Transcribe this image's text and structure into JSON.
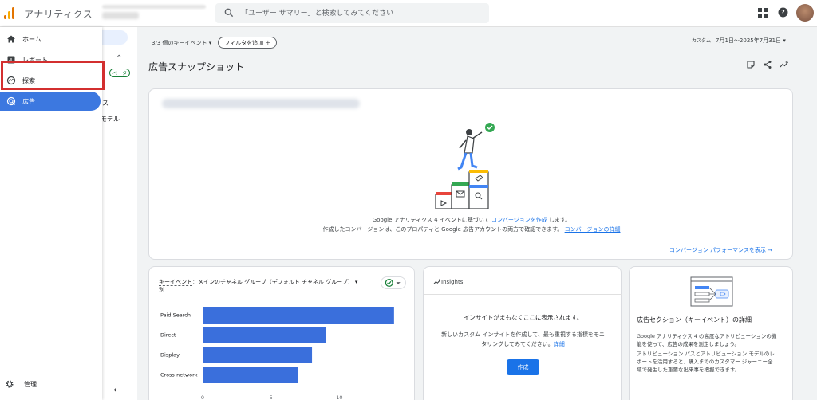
{
  "app": {
    "title": "アナリティクス"
  },
  "search": {
    "placeholder": "「ユーザー サマリー」と検索してみてください"
  },
  "colors": {
    "accent": "#1a73e8",
    "active_nav": "#3c78e0",
    "highlight": "#d32f2f",
    "chart_bar": "#3a6fdc"
  },
  "nav": {
    "items": [
      {
        "label": "ホーム",
        "icon": "home-icon"
      },
      {
        "label": "レポート",
        "icon": "reports-icon"
      },
      {
        "label": "探索",
        "icon": "explore-icon"
      },
      {
        "label": "広告",
        "icon": "advertising-icon",
        "active": true
      }
    ],
    "admin": {
      "label": "管理",
      "icon": "gear-icon"
    }
  },
  "subnav": {
    "beta": "ベータ",
    "item1": "ス",
    "item2": "モデル"
  },
  "filters": {
    "key_events": "3/3 個のキーイベント ▾",
    "add_filter": "フィルタを追加 ＋"
  },
  "date_range": {
    "mode": "カスタム",
    "range": "7月1日～2025年7月31日 ▾"
  },
  "page": {
    "title": "広告スナップショット"
  },
  "conversions": {
    "line1_pre": "Google アナリティクス 4 イベントに基づいて",
    "line1_link": "コンバージョンを作成",
    "line1_post": "します。",
    "line2_pre": "作成したコンバージョンは、このプロパティと Google 広告アカウントの両方で確認できます。",
    "line2_link": "コンバージョンの詳細",
    "perf_link": "コンバージョン パフォーマンスを表示 →"
  },
  "chart_card": {
    "title_key": "キーイベント",
    "title_rest": "：メインのチャネル グループ（デフォルト チャネル グループ） ▾",
    "title_line2": "別"
  },
  "chart_data": {
    "type": "bar",
    "orientation": "horizontal",
    "categories": [
      "Paid Search",
      "Direct",
      "Display",
      "Cross-network"
    ],
    "values": [
      14,
      9,
      8,
      7
    ],
    "xticks": [
      0,
      5,
      10
    ],
    "xlim": [
      0,
      14.3
    ],
    "grid": false
  },
  "insights": {
    "header": "Insights",
    "heading": "インサイトがまもなくここに表示されます。",
    "desc_line1": "新しいカスタム インサイトを作成して、最も重視する指標をモニ",
    "desc_line2_pre": "タリングしてみてください。",
    "desc_link": "詳細",
    "create_button": "作成"
  },
  "attribution": {
    "title": "広告セクション（キーイベント）の詳細",
    "p1_l1": "Google アナリティクス 4 の高度なアトリビューションの機",
    "p1_l2": "能を使って、広告の成果を測定しましょう。",
    "p2_l1": "アトリビューション パスとアトリビューション モデルのレ",
    "p2_l2": "ポートを活用すると、購入までのカスタマー ジャーニー全",
    "p2_l3": "域で発生した重要な出来事を把握できます。"
  }
}
